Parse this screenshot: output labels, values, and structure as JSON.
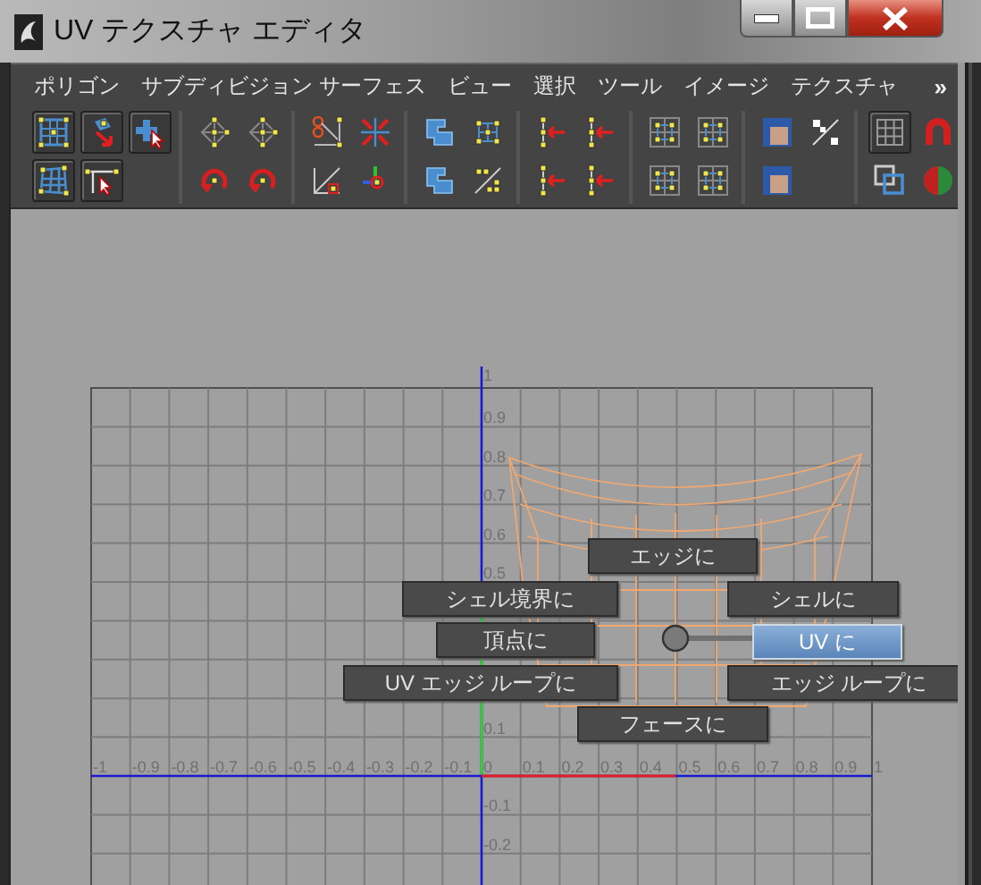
{
  "window": {
    "title": "UV テクスチャ エディタ"
  },
  "menu": {
    "items": [
      "ポリゴン",
      "サブディビジョン サーフェス",
      "ビュー",
      "選択",
      "ツール",
      "イメージ",
      "テクスチャ"
    ],
    "overflow": "»"
  },
  "toolbar": {
    "groups": [
      [
        {
          "pressed": true
        },
        {
          "pressed": true
        },
        {
          "pressed": true
        },
        {
          "pressed": true
        },
        {
          "pressed": true
        }
      ],
      [
        {
          "pressed": false
        },
        {
          "pressed": false
        },
        {
          "pressed": false
        },
        {
          "pressed": false
        }
      ],
      [
        {
          "pressed": false
        },
        {
          "pressed": false
        },
        {
          "pressed": false
        },
        {
          "pressed": false
        }
      ],
      [
        {
          "pressed": false
        },
        {
          "pressed": false
        },
        {
          "pressed": false
        },
        {
          "pressed": false
        }
      ],
      [
        {
          "pressed": false
        },
        {
          "pressed": false
        },
        {
          "pressed": false
        },
        {
          "pressed": false
        }
      ],
      [
        {
          "pressed": false
        },
        {
          "pressed": false
        },
        {
          "pressed": false
        },
        {
          "pressed": false
        }
      ],
      [
        {
          "pressed": false
        },
        {
          "pressed": false
        },
        {
          "pressed": false
        }
      ],
      [
        {
          "pressed": true
        },
        {
          "pressed": false
        },
        {
          "pressed": false
        },
        {
          "pressed": false
        }
      ]
    ]
  },
  "uv_view": {
    "x_ticks": [
      "-1",
      "-0.9",
      "-0.8",
      "-0.7",
      "-0.6",
      "-0.5",
      "-0.4",
      "-0.3",
      "-0.2",
      "-0.1",
      "0",
      "0.1",
      "0.2",
      "0.3",
      "0.4",
      "0.5",
      "0.6",
      "0.7",
      "0.8",
      "0.9",
      "1"
    ],
    "y_ticks": [
      "1",
      "0.9",
      "0.8",
      "0.7",
      "0.6",
      "0.5",
      "0.1",
      "-0.1",
      "-0.2"
    ]
  },
  "marking_menu": [
    {
      "label": "エッジに",
      "selected": false
    },
    {
      "label": "シェル境界に",
      "selected": false
    },
    {
      "label": "シェルに",
      "selected": false
    },
    {
      "label": "頂点に",
      "selected": false
    },
    {
      "label": "UV に",
      "selected": true
    },
    {
      "label": "UV エッジ ループに",
      "selected": false
    },
    {
      "label": "エッジ ループに",
      "selected": false
    },
    {
      "label": "フェースに",
      "selected": false
    }
  ]
}
